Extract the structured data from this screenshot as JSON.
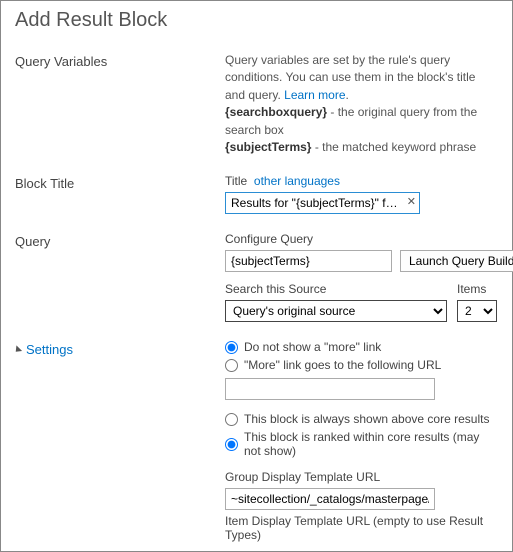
{
  "page_title": "Add Result Block",
  "query_variables": {
    "label": "Query Variables",
    "help_pre": "Query variables are set by the rule's query conditions. You can use them in the block's title and query. ",
    "learn_more": "Learn more",
    "help_post": ".",
    "var1_name": "{searchboxquery}",
    "var1_desc": " - the original query from the search box",
    "var2_name": "{subjectTerms}",
    "var2_desc": " - the matched keyword phrase"
  },
  "block_title": {
    "label": "Block Title",
    "title_label": "Title",
    "other_languages": "other languages",
    "value": "Results for \"{subjectTerms}\" from SharePoint"
  },
  "query": {
    "label": "Query",
    "configure_label": "Configure Query",
    "value": "{subjectTerms}",
    "launch_label": "Launch Query Builder",
    "source_label": "Search this Source",
    "source_value": "Query's original source",
    "items_label": "Items",
    "items_value": "2"
  },
  "settings": {
    "label": "Settings",
    "more_none": "Do not show a \"more\" link",
    "more_url": "\"More\" link goes to the following URL",
    "more_url_value": "",
    "position_above": "This block is always shown above core results",
    "position_ranked": "This block is ranked within core results (may not show)",
    "group_template_label": "Group Display Template URL",
    "group_template_value": "~sitecollection/_catalogs/masterpage/Display Templates/Search/Group_Default.js",
    "item_template_label": "Item Display Template URL (empty to use Result Types)"
  }
}
